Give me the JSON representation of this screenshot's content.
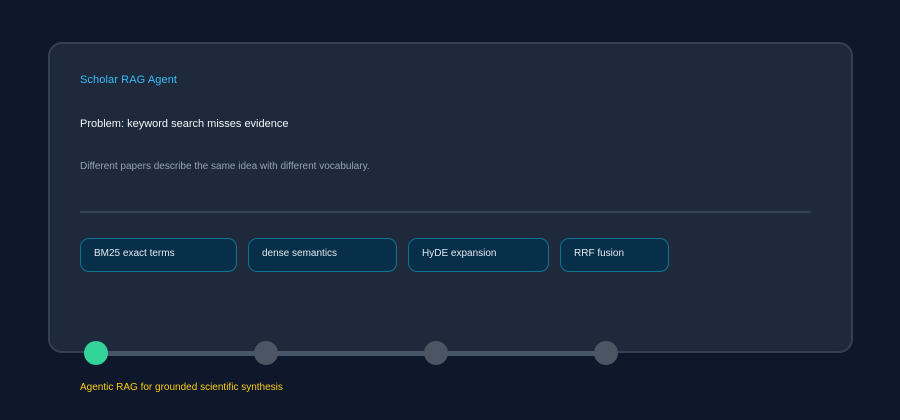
{
  "card": {
    "eyebrow": "Scholar RAG Agent",
    "title": "Problem: keyword search misses evidence",
    "subtitle": "Different papers describe the same idea with different vocabulary.",
    "chips": [
      {
        "label": "BM25 exact terms"
      },
      {
        "label": "dense semantics"
      },
      {
        "label": "HyDE expansion"
      },
      {
        "label": "RRF fusion"
      }
    ]
  },
  "progress": {
    "total_steps": 4,
    "current_step": 1
  },
  "caption": "Agentic RAG for grounded scientific synthesis",
  "colors": {
    "background": "#0f172a",
    "card": "#1e293b",
    "accent": "#38bdf8",
    "chip_fill": "#082f49",
    "chip_border": "#0e7490",
    "step_active": "#34d399",
    "step_inactive": "#4b5563",
    "caption": "#facc15"
  }
}
